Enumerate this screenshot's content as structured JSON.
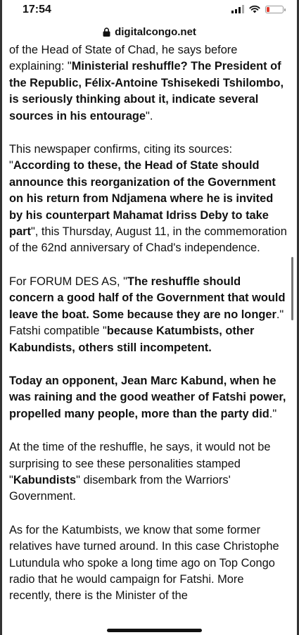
{
  "status_bar": {
    "time": "17:54"
  },
  "browser": {
    "url": "digitalcongo.net"
  },
  "article": {
    "p1": [
      {
        "text": "of the Head of State of Chad, he says before explaining: \"",
        "bold": false
      },
      {
        "text": "Ministerial reshuffle? The President of the Republic, Félix-Antoine Tshisekedi Tshilombo, is seriously thinking about it, indicate several sources in his entourage",
        "bold": true
      },
      {
        "text": "\".",
        "bold": false
      }
    ],
    "p2": [
      {
        "text": "This newspaper confirms, citing its sources: \"",
        "bold": false
      },
      {
        "text": "According to these, the Head of State should announce this reorganization of the Government on his return from Ndjamena where he is invited by his counterpart Mahamat Idriss Deby to take part",
        "bold": true
      },
      {
        "text": "\", this Thursday, August 11, in the commemoration of the 62nd anniversary of Chad's independence.",
        "bold": false
      }
    ],
    "p3": [
      {
        "text": "For FORUM DES AS, \"",
        "bold": false
      },
      {
        "text": "The reshuffle should concern a good half of the Government that would leave the boat. Some because they are no longer",
        "bold": true
      },
      {
        "text": ".\" Fatshi compatible \"",
        "bold": false
      },
      {
        "text": "because Katumbists, other Kabundists, others still incompetent.",
        "bold": true
      }
    ],
    "p4": [
      {
        "text": "Today an opponent, Jean Marc Kabund, when he was raining and the good weather of Fatshi power, propelled many people, more than the party did",
        "bold": true
      },
      {
        "text": ".\"",
        "bold": false
      }
    ],
    "p5": [
      {
        "text": "At the time of the reshuffle, he says, it would not be surprising to see these personalities stamped \"",
        "bold": false
      },
      {
        "text": "Kabundists",
        "bold": true
      },
      {
        "text": "\" disembark from the Warriors' Government.",
        "bold": false
      }
    ],
    "p6": [
      {
        "text": "As for the Katumbists, we know that some former relatives have turned around. In this case Christophe Lutundula who spoke a long time ago on Top Congo radio that he would campaign for Fatshi. More recently, there is the Minister of the",
        "bold": false
      }
    ]
  }
}
